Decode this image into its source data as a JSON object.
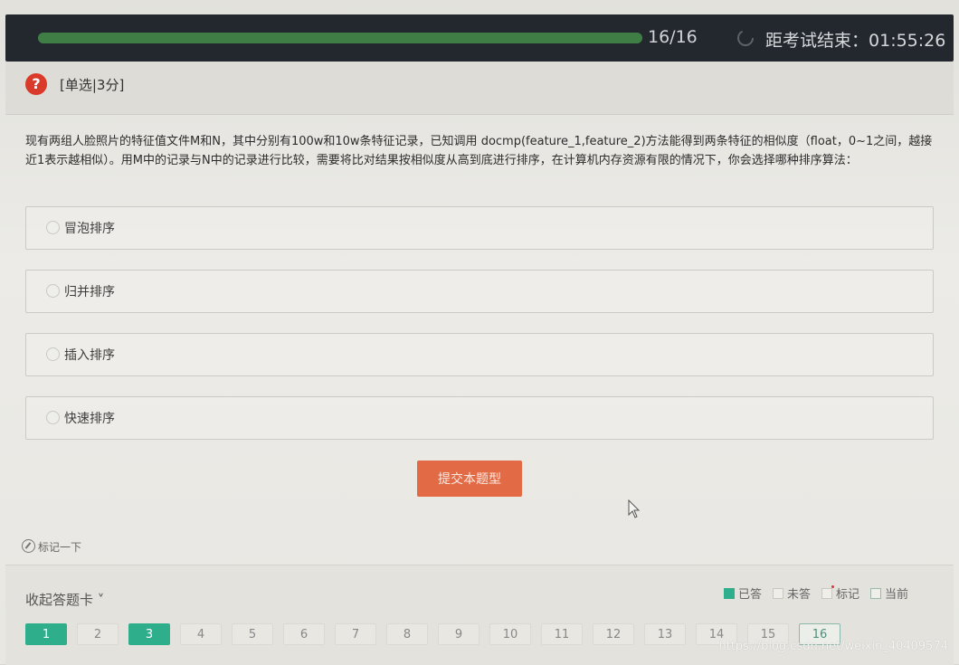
{
  "progress": {
    "current": 16,
    "total": 16,
    "label": "16/16",
    "fill_fraction": 1.0
  },
  "timer": {
    "label": "距考试结束：",
    "value": "01:55:26"
  },
  "question": {
    "type_label": "[单选|3分]",
    "text": "现有两组人脸照片的特征值文件M和N，其中分别有100w和10w条特征记录，已知调用 docmp(feature_1,feature_2)方法能得到两条特征的相似度（float，0~1之间，越接近1表示越相似）。用M中的记录与N中的记录进行比较，需要将比对结果按相似度从高到底进行排序，在计算机内存资源有限的情况下，你会选择哪种排序算法：",
    "options": [
      {
        "label": "冒泡排序"
      },
      {
        "label": "归并排序"
      },
      {
        "label": "插入排序"
      },
      {
        "label": "快速排序"
      }
    ]
  },
  "submit_label": "提交本题型",
  "mark_label": "标记一下",
  "answer_card": {
    "collapse_label": "收起答题卡 ˅",
    "legend": {
      "answered": "已答",
      "unanswered": "未答",
      "marked": "标记",
      "current": "当前"
    },
    "numbers": [
      {
        "label": "1",
        "state": "answered"
      },
      {
        "label": "2",
        "state": "unanswered"
      },
      {
        "label": "3",
        "state": "answered"
      },
      {
        "label": "4",
        "state": "unanswered"
      },
      {
        "label": "5",
        "state": "unanswered"
      },
      {
        "label": "6",
        "state": "unanswered"
      },
      {
        "label": "7",
        "state": "unanswered"
      },
      {
        "label": "8",
        "state": "unanswered"
      },
      {
        "label": "9",
        "state": "unanswered"
      },
      {
        "label": "10",
        "state": "unanswered"
      },
      {
        "label": "11",
        "state": "unanswered"
      },
      {
        "label": "12",
        "state": "unanswered"
      },
      {
        "label": "13",
        "state": "unanswered"
      },
      {
        "label": "14",
        "state": "unanswered"
      },
      {
        "label": "15",
        "state": "unanswered"
      },
      {
        "label": "16",
        "state": "current"
      }
    ]
  },
  "watermark": "https://blog.csdn.net/weixin_40409574",
  "colors": {
    "accent_green": "#2fae8c",
    "submit_orange": "#e26a45",
    "help_red": "#d93a2a",
    "topbar_dark": "#23272e"
  },
  "icons": {
    "help": "question-circle-icon",
    "clock": "clock-icon",
    "mark": "pen-icon",
    "cursor": "mouse-pointer-icon"
  }
}
